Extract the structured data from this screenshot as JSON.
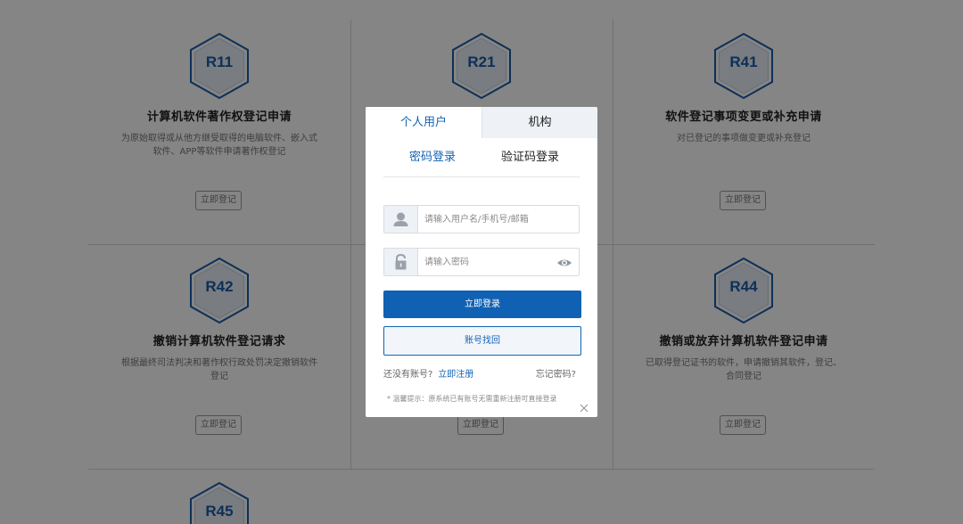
{
  "cards": [
    {
      "code": "R11",
      "title": "计算机软件著作权登记申请",
      "desc": "为原始取得或从他方继受取得的电脑软件、嵌入式软件、APP等软件申请著作权登记",
      "button": "立即登记"
    },
    {
      "code": "R21",
      "title": "",
      "desc": "",
      "button": ""
    },
    {
      "code": "R41",
      "title": "软件登记事项变更或补充申请",
      "desc": "对已登记的事项做变更或补充登记",
      "button": "立即登记"
    },
    {
      "code": "R42",
      "title": "撤销计算机软件登记请求",
      "desc": "根据最终司法判决和著作权行政处罚决定撤销软件登记",
      "button": "立即登记"
    },
    {
      "code": "",
      "title": "",
      "desc": "",
      "button": "立即登记"
    },
    {
      "code": "R44",
      "title": "撤销或放弃计算机软件登记申请",
      "desc": "已取得登记证书的软件，申请撤销其软件，登记、合同登记",
      "button": "立即登记"
    },
    {
      "code": "R45",
      "title": "",
      "desc": "",
      "button": ""
    }
  ],
  "login": {
    "tab_personal": "个人用户",
    "tab_org": "机构",
    "subtab_password": "密码登录",
    "subtab_code": "验证码登录",
    "username_placeholder": "请输入用户名/手机号/邮箱",
    "password_placeholder": "请输入密码",
    "login_button": "立即登录",
    "recover_button": "账号找回",
    "no_account": "还没有账号?",
    "register_link": "立即注册",
    "forgot": "忘记密码?",
    "tip": "* 温馨提示：原系统已有账号无需重新注册可直接登录"
  },
  "icons": {
    "user": "user-icon",
    "lock": "lock-icon",
    "eye": "eye-icon",
    "close": "close-icon",
    "hexagon": "hexagon-badge"
  },
  "colors": {
    "accent": "#1463b4",
    "primary_button": "#1061b3",
    "overlay": "rgba(0,0,0,0.48)"
  }
}
